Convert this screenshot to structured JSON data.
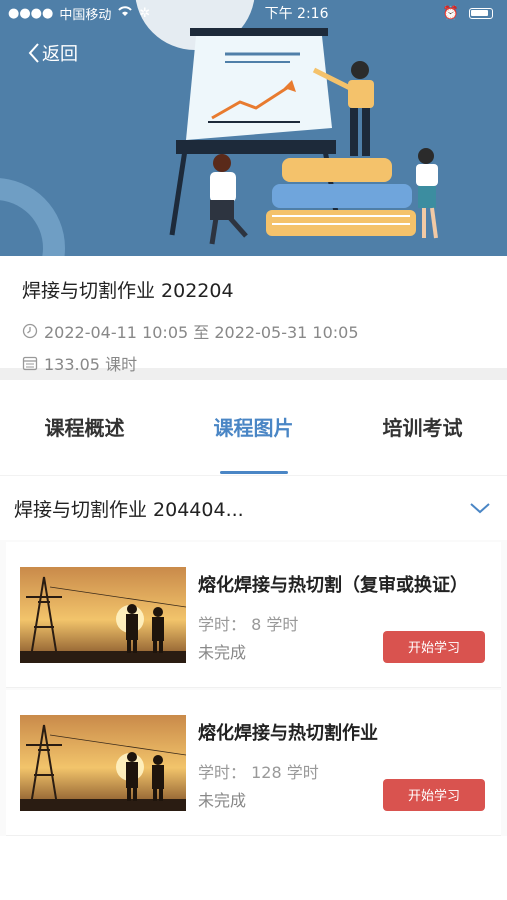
{
  "status_bar": {
    "carrier": "中国移动",
    "time": "下午 2:16"
  },
  "nav": {
    "back_label": "返回"
  },
  "course": {
    "title": "焊接与切割作业 202204",
    "date_range": "2022-04-11 10:05 至 2022-05-31 10:05",
    "hours": "133.05 课时"
  },
  "tabs": [
    {
      "label": "课程概述",
      "active": false
    },
    {
      "label": "课程图片",
      "active": true
    },
    {
      "label": "培训考试",
      "active": false
    }
  ],
  "section": {
    "selected": "焊接与切割作业 204404..."
  },
  "lessons": [
    {
      "title": "熔化焊接与热切割（复审或换证）",
      "hours": "学时：  8 学时",
      "status": "未完成",
      "button": "开始学习"
    },
    {
      "title": "熔化焊接与热切割作业",
      "hours": "学时：  128 学时",
      "status": "未完成",
      "button": "开始学习"
    }
  ],
  "colors": {
    "accent": "#4a86c5",
    "hero_bg": "#4f7fa8",
    "button": "#d9534f"
  }
}
